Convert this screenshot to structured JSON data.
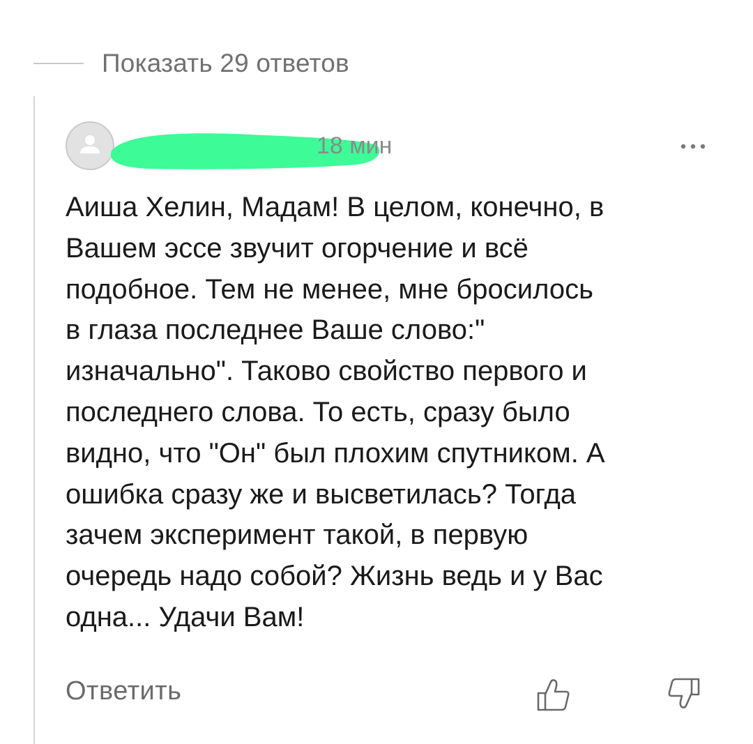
{
  "thread": {
    "show_replies_label": "Показать 29 ответов"
  },
  "comment": {
    "timestamp": "18 мин",
    "body": "Аиша Хелин, Мадам! В целом, конечно, в\nВашем эссе звучит огорчение и всё\nподобное. Тем не менее, мне бросилось\nв глаза последнее  Ваше слово:\"\nизначально\". Таково свойство первого и\nпоследнего слова.  То есть, сразу было\nвидно, что \"Он\" был плохим спутником. А\nошибка сразу же и высветилась? Тогда\nзачем эксперимент такой, в первую\nочередь надо собой? Жизнь ведь  и у Вас\nодна... Удачи Вам!",
    "reply_label": "Ответить",
    "icons": {
      "avatar": "user-placeholder-icon",
      "more": "more-dots-icon",
      "like": "thumbs-up-icon",
      "dislike": "thumbs-down-icon"
    },
    "colors": {
      "redaction": "#3dfb97",
      "muted_text": "#707070",
      "body_text": "#1a1a1a"
    }
  }
}
